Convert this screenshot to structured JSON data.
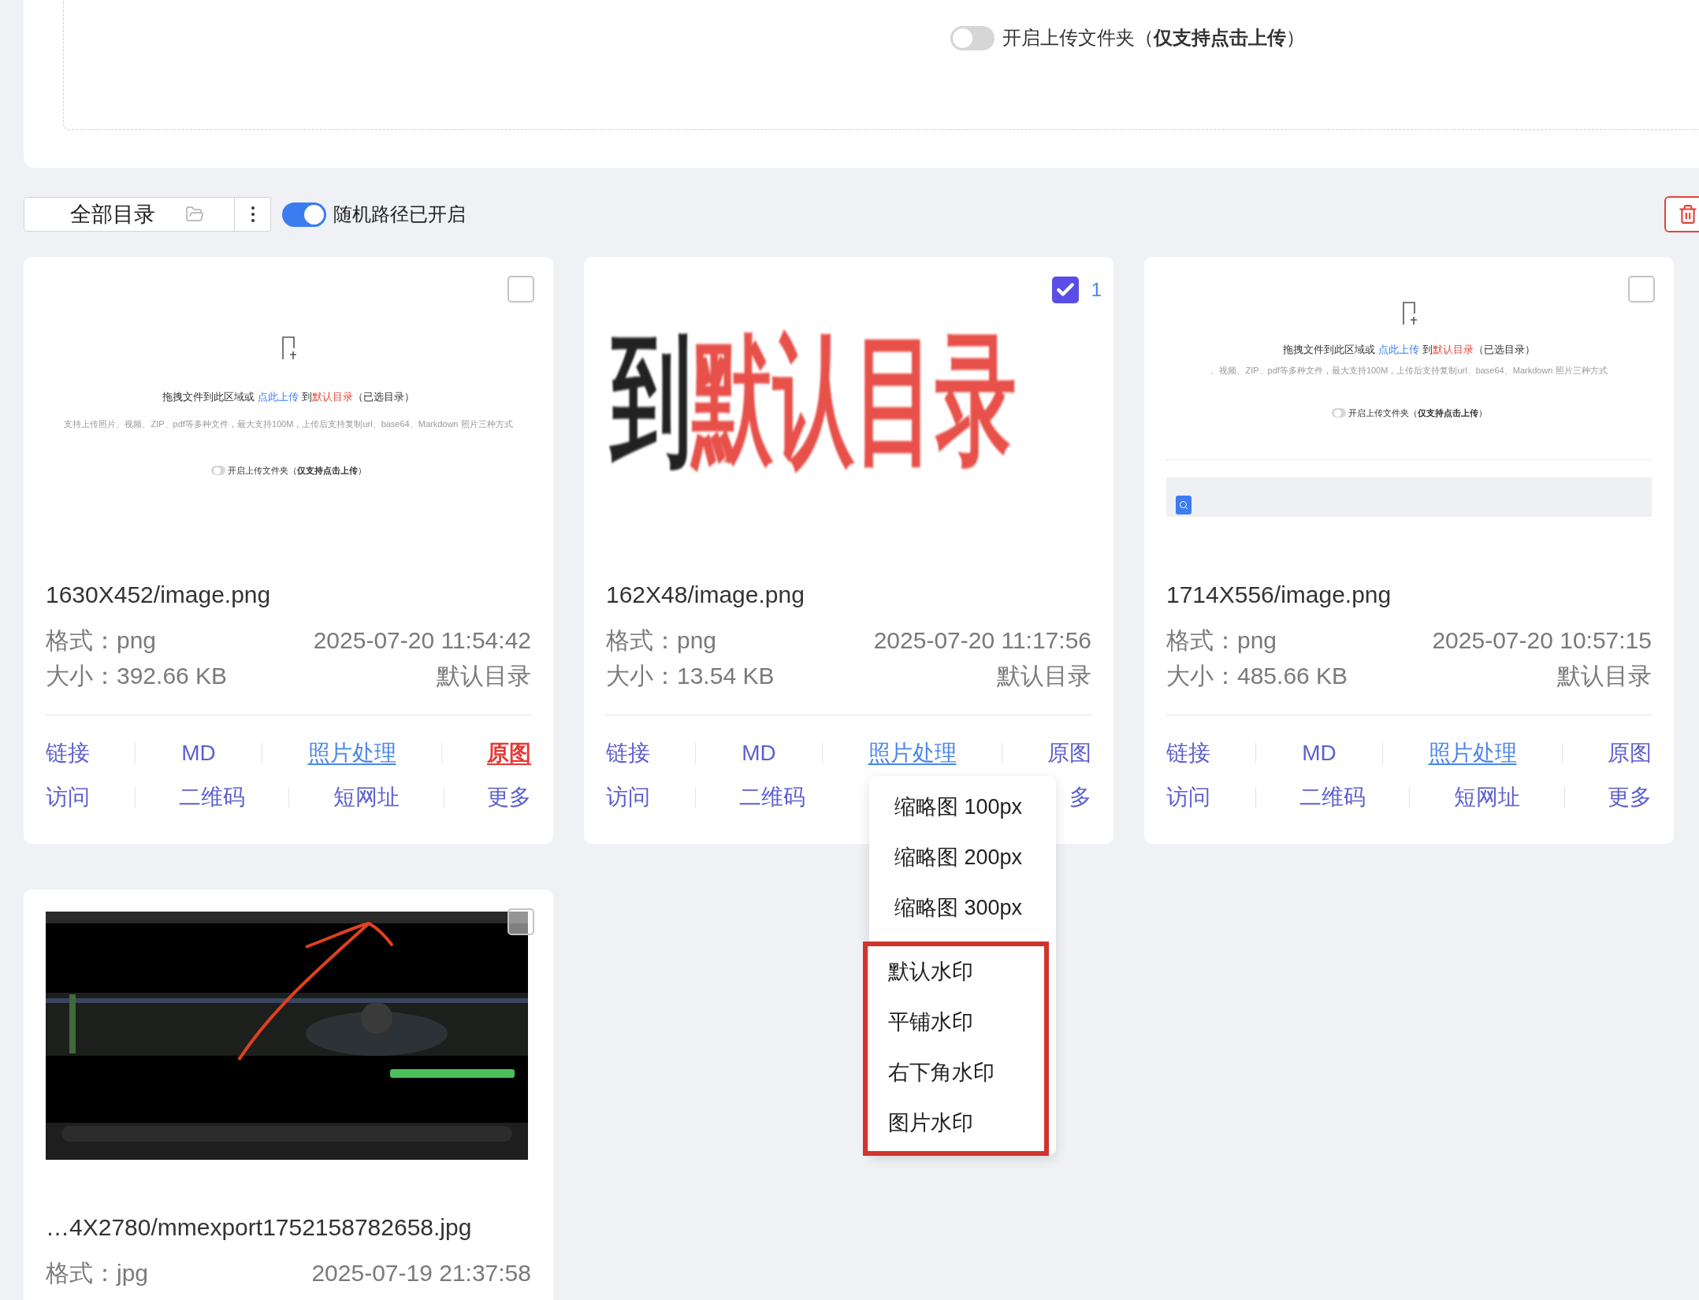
{
  "upload_panel": {
    "folder_toggle": {
      "on": false,
      "label": "开启上传文件夹（**仅支持点击上传**）"
    }
  },
  "toolbar": {
    "directory": "全部目录",
    "random_path": {
      "on": true,
      "label": "随机路径已开启"
    }
  },
  "cards": [
    {
      "thumbnail": {
        "kind": "upload-screenshot",
        "instruction": {
          "before": "拖拽文件到此区域或",
          "link": "点此上传",
          "after": "到",
          "target": "默认目录",
          "suffix": "（已选目录）"
        },
        "hint": "支持上传照片、视频、ZIP、pdf等多种文件，最大支持100M，上传后支持复制url、base64、Markdown 照片三种方式",
        "toggle_label": "开启上传文件夹（**仅支持点击上传**）"
      },
      "checked": false,
      "filename": "1630X452/image.png",
      "format": "格式：png",
      "date": "2025-07-20 11:54:42",
      "size": "大小：392.66 KB",
      "directory": "默认目录",
      "actions": [
        [
          {
            "label": "链接",
            "underline": false,
            "hovered": false
          },
          {
            "label": "MD",
            "underline": false,
            "hovered": false
          },
          {
            "label": "照片处理",
            "underline": true,
            "hovered": false
          },
          {
            "label": "原图",
            "underline": true,
            "hovered": true
          }
        ],
        [
          {
            "label": "访问",
            "underline": false,
            "hovered": false
          },
          {
            "label": "二维码",
            "underline": false,
            "hovered": false
          },
          {
            "label": "短网址",
            "underline": false,
            "hovered": false
          },
          {
            "label": "更多",
            "underline": false,
            "hovered": false
          }
        ]
      ]
    },
    {
      "thumbnail": {
        "kind": "zoomed-text",
        "text": "到",
        "highlight": "默认目录"
      },
      "checked": true,
      "selection_count": "1",
      "filename": "162X48/image.png",
      "format": "格式：png",
      "date": "2025-07-20 11:17:56",
      "size": "大小：13.54 KB",
      "directory": "默认目录",
      "actions": [
        [
          {
            "label": "链接",
            "underline": false,
            "hovered": false
          },
          {
            "label": "MD",
            "underline": false,
            "hovered": false
          },
          {
            "label": "照片处理",
            "underline": true,
            "hovered": false
          },
          {
            "label": "原图",
            "underline": false,
            "hovered": false
          }
        ],
        [
          {
            "label": "访问",
            "underline": false,
            "hovered": false
          },
          {
            "label": "二维码",
            "underline": false,
            "hovered": false
          },
          {
            "label": "多",
            "underline": false,
            "hovered": false
          }
        ]
      ]
    },
    {
      "thumbnail": {
        "kind": "upload-page",
        "instruction": {
          "before": "拖拽文件到此区域或",
          "link": "点此上传",
          "after": "到",
          "target": "默认目录",
          "suffix": "（已选目录）"
        },
        "hint": "、视频、ZIP、pdf等多种文件，最大支持100M，上传后支持复制url、base64、Markdown 照片三种方式",
        "toggle_label": "开启上传文件夹（**仅支持点击上传**）"
      },
      "checked": false,
      "filename": "1714X556/image.png",
      "format": "格式：png",
      "date": "2025-07-20 10:57:15",
      "size": "大小：485.66 KB",
      "directory": "默认目录",
      "actions": [
        [
          {
            "label": "链接",
            "underline": false,
            "hovered": false
          },
          {
            "label": "MD",
            "underline": false,
            "hovered": false
          },
          {
            "label": "照片处理",
            "underline": true,
            "hovered": false
          },
          {
            "label": "原图",
            "underline": false,
            "hovered": false
          }
        ],
        [
          {
            "label": "访问",
            "underline": false,
            "hovered": false
          },
          {
            "label": "二维码",
            "underline": false,
            "hovered": false
          },
          {
            "label": "短网址",
            "underline": false,
            "hovered": false
          },
          {
            "label": "更多",
            "underline": false,
            "hovered": false
          }
        ]
      ]
    },
    {
      "checked": false,
      "filename": "…4X2780/mmexport1752158782658.jpg",
      "format": "格式：jpg",
      "date": "2025-07-19 21:37:58"
    }
  ],
  "menu": {
    "items": [
      {
        "label": "缩略图 100px",
        "outlined": false
      },
      {
        "label": "缩略图 200px",
        "outlined": false
      },
      {
        "label": "缩略图 300px",
        "outlined": false
      },
      {
        "label": "默认水印",
        "outlined": true
      },
      {
        "label": "平铺水印",
        "outlined": true
      },
      {
        "label": "右下角水印",
        "outlined": true
      },
      {
        "label": "图片水印",
        "outlined": true
      }
    ]
  }
}
